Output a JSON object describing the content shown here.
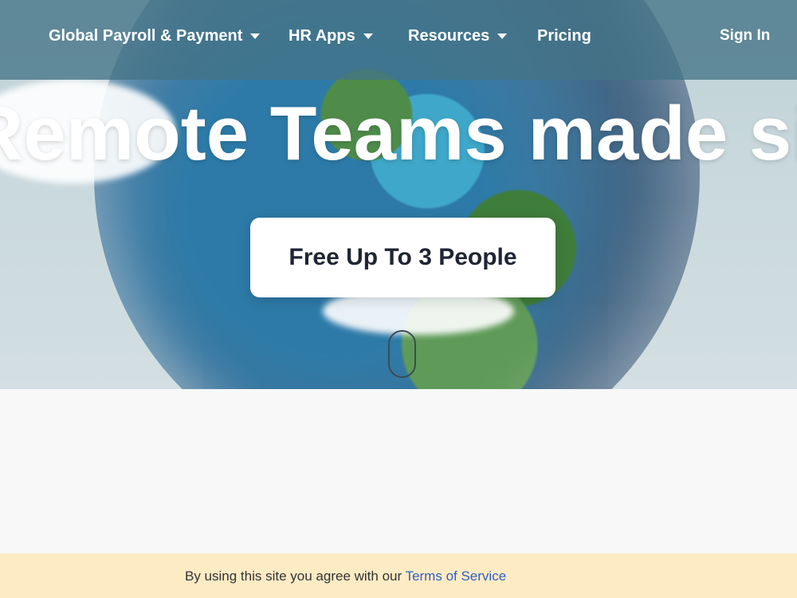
{
  "nav": {
    "items": [
      {
        "label": "Global Payroll & Payment"
      },
      {
        "label": "HR Apps"
      },
      {
        "label": "Resources"
      },
      {
        "label": "Pricing"
      }
    ],
    "sign_in": "Sign In"
  },
  "hero": {
    "headline": "Remote Teams made simple",
    "cta_label": "Free Up To 3 People"
  },
  "cookie": {
    "text": "By using this site you agree with our ",
    "link": "Terms of Service"
  },
  "colors": {
    "navbar_bg": "#447387",
    "cookie_bg": "#fdebc4",
    "link": "#2f5fc4",
    "cta_text": "#1f2533"
  }
}
